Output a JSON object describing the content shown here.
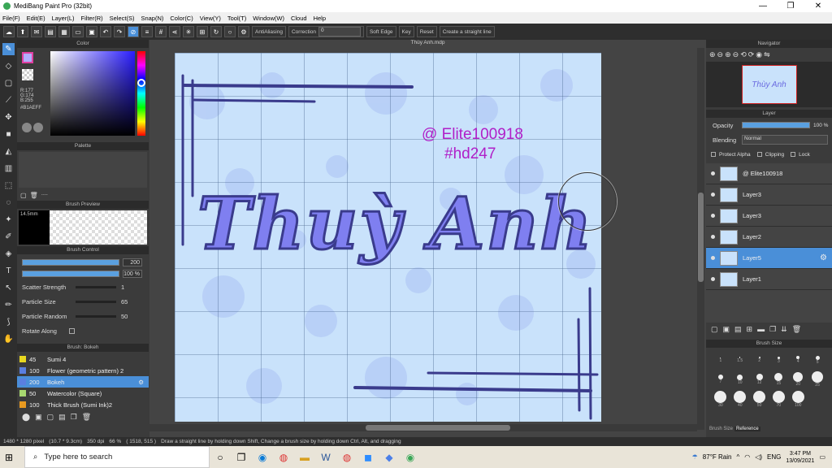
{
  "window": {
    "title": "MediBang Paint Pro (32bit)",
    "min": "—",
    "max": "❐",
    "close": "✕"
  },
  "menu": [
    "File(F)",
    "Edit(E)",
    "Layer(L)",
    "Filter(R)",
    "Select(S)",
    "Snap(N)",
    "Color(C)",
    "View(Y)",
    "Tool(T)",
    "Window(W)",
    "Cloud",
    "Help"
  ],
  "toolbar": {
    "antialias_label": "AntiAliasing",
    "correction_label": "Correction",
    "correction_value": "0",
    "soft_edge_label": "Soft Edge",
    "key_label": "Key",
    "reset_label": "Reset",
    "straight_line_label": "Create a straight line"
  },
  "color_panel": {
    "title": "Color",
    "r": "R:177",
    "g": "G:174",
    "b": "B:255",
    "hex": "#B1AEFF"
  },
  "palette_panel": {
    "title": "Palette",
    "count": "----"
  },
  "brush_preview": {
    "title": "Brush Preview",
    "size": "14.5mm"
  },
  "brush_control": {
    "title": "Brush Control",
    "size_value": "200",
    "opacity_value": "100 %",
    "params": [
      {
        "label": "Scatter Strength",
        "value": "1"
      },
      {
        "label": "Particle Size",
        "value": "65"
      },
      {
        "label": "Particle Random",
        "value": "50"
      },
      {
        "label": "Rotate Along",
        "value": ""
      }
    ]
  },
  "brush_list": {
    "title": "Brush: Bokeh",
    "items": [
      {
        "size": "45",
        "name": "Sumi 4",
        "color": "#e8d820"
      },
      {
        "size": "100",
        "name": "Flower (geometric pattern) 2",
        "color": "#5a7fe0"
      },
      {
        "size": "200",
        "name": "Bokeh",
        "color": "#5a7fe0"
      },
      {
        "size": "50",
        "name": "Watercolor (Square)",
        "color": "#a8d870"
      },
      {
        "size": "100",
        "name": "Thick Brush (Sumi Ink)2",
        "color": "#e89a20"
      }
    ]
  },
  "document": {
    "name": "Thùy Anh.mdp",
    "text_main": "Thuỳ Anh",
    "watermark_line1": "@ Elite100918",
    "watermark_line2": "#hd247"
  },
  "navigator": {
    "title": "Navigator",
    "thumb_text": "Thùy Anh"
  },
  "layer_panel": {
    "title": "Layer",
    "opacity_label": "Opacity",
    "opacity_value": "100 %",
    "blending_label": "Blending",
    "blending_value": "Normal",
    "protect_alpha": "Protect Alpha",
    "clipping": "Clipping",
    "lock": "Lock",
    "layers": [
      "@ Elite100918",
      "Layer3",
      "Layer3",
      "Layer2",
      "Layer5",
      "Layer1"
    ]
  },
  "brush_size_panel": {
    "title": "Brush Size",
    "sizes": [
      "1",
      "1.5",
      "2",
      "3",
      "4",
      "5",
      "7",
      "10",
      "12",
      "15",
      "20",
      "25",
      "30",
      "40",
      "50",
      "70",
      "100"
    ],
    "tabs": [
      "Brush Size",
      "Reference"
    ]
  },
  "status": {
    "dims": "1480 * 1280 pixel",
    "cm": "(10.7 * 9.3cm)",
    "dpi": "350 dpi",
    "zoom": "66 %",
    "coords": "( 1518, 515 )",
    "hint": "Draw a straight line by holding down Shift, Change a brush size by holding down Ctrl, Alt, and dragging"
  },
  "taskbar": {
    "search_placeholder": "Type here to search",
    "weather": "87°F Rain",
    "lang": "ENG",
    "time": "3:47 PM",
    "date": "13/09/2021"
  },
  "colors": {
    "accent": "#4a8fd8",
    "canvas_bg": "#c9e2fb",
    "lines": "#3a3b8c",
    "watermark": "#b020c8"
  }
}
